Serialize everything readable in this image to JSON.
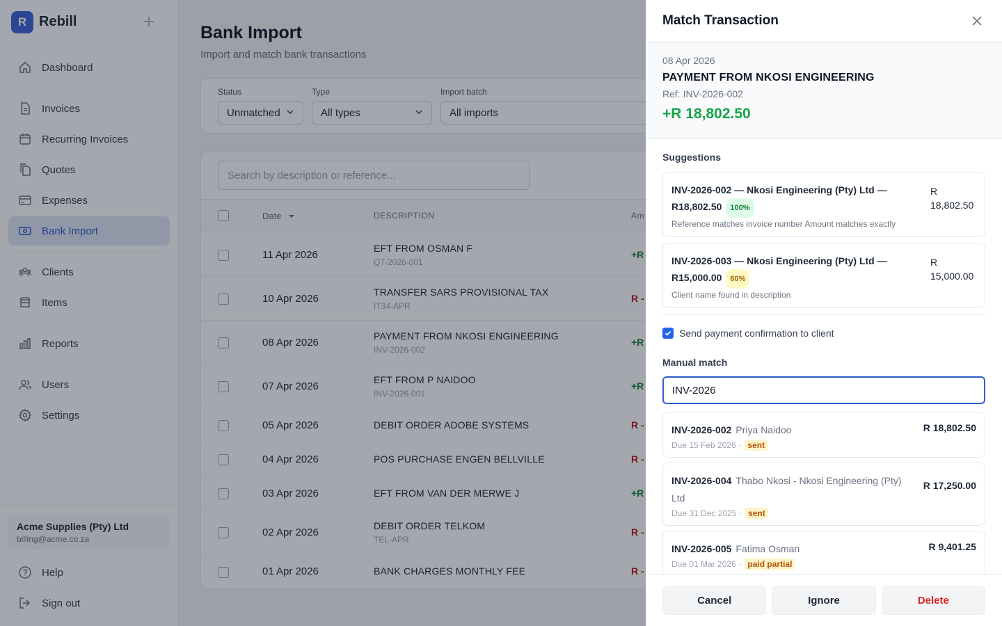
{
  "brand": {
    "letter": "R",
    "name": "Rebill",
    "add_icon": "plus-icon"
  },
  "sidebar": {
    "items": [
      {
        "label": "Dashboard",
        "icon": "home-icon"
      },
      {
        "label": "Invoices",
        "icon": "document-icon"
      },
      {
        "label": "Recurring Invoices",
        "icon": "calendar-icon"
      },
      {
        "label": "Quotes",
        "icon": "copy-icon"
      },
      {
        "label": "Expenses",
        "icon": "credit-card-icon"
      },
      {
        "label": "Bank Import",
        "icon": "banknote-icon",
        "active": true
      },
      {
        "label": "Clients",
        "icon": "users-icon"
      },
      {
        "label": "Items",
        "icon": "box-icon"
      },
      {
        "label": "Reports",
        "icon": "bar-chart-icon"
      },
      {
        "label": "Users",
        "icon": "user-group-icon"
      },
      {
        "label": "Settings",
        "icon": "gear-icon"
      }
    ],
    "account": {
      "name": "Acme Supplies (Pty) Ltd",
      "email": "billing@acme.co.za"
    },
    "help": "Help",
    "sign_out": "Sign out"
  },
  "page": {
    "title": "Bank Import",
    "subtitle": "Import and match bank transactions"
  },
  "filters": {
    "status": {
      "label": "Status",
      "value": "Unmatched"
    },
    "type": {
      "label": "Type",
      "value": "All types"
    },
    "batch": {
      "label": "Import batch",
      "value": "All imports"
    }
  },
  "table": {
    "search_placeholder": "Search by description or reference...",
    "headers": {
      "date": "Date",
      "description": "DESCRIPTION",
      "amount": "Am"
    },
    "rows": [
      {
        "date": "11 Apr 2026",
        "description": "EFT FROM OSMAN F",
        "ref": "QT-2026-001",
        "amount": "+R",
        "sign": "pos"
      },
      {
        "date": "10 Apr 2026",
        "description": "TRANSFER SARS PROVISIONAL TAX",
        "ref": "IT34-APR",
        "amount": "R -",
        "sign": "neg"
      },
      {
        "date": "08 Apr 2026",
        "description": "PAYMENT FROM NKOSI ENGINEERING",
        "ref": "INV-2026-002",
        "amount": "+R",
        "sign": "pos"
      },
      {
        "date": "07 Apr 2026",
        "description": "EFT FROM P NAIDOO",
        "ref": "INV-2026-001",
        "amount": "+R",
        "sign": "pos"
      },
      {
        "date": "05 Apr 2026",
        "description": "DEBIT ORDER ADOBE SYSTEMS",
        "ref": "",
        "amount": "R -",
        "sign": "neg"
      },
      {
        "date": "04 Apr 2026",
        "description": "POS PURCHASE ENGEN BELLVILLE",
        "ref": "",
        "amount": "R -",
        "sign": "neg"
      },
      {
        "date": "03 Apr 2026",
        "description": "EFT FROM VAN DER MERWE J",
        "ref": "",
        "amount": "+R",
        "sign": "pos"
      },
      {
        "date": "02 Apr 2026",
        "description": "DEBIT ORDER TELKOM",
        "ref": "TEL-APR",
        "amount": "R -",
        "sign": "neg"
      },
      {
        "date": "01 Apr 2026",
        "description": "BANK CHARGES MONTHLY FEE",
        "ref": "",
        "amount": "R -",
        "sign": "neg"
      }
    ]
  },
  "panel": {
    "title": "Match Transaction",
    "close_icon": "close-icon",
    "transaction": {
      "date": "08 Apr 2026",
      "description": "PAYMENT FROM NKOSI ENGINEERING",
      "ref": "Ref: INV-2026-002",
      "amount": "+R 18,802.50"
    },
    "suggestions_heading": "Suggestions",
    "suggestions": [
      {
        "title": "INV-2026-002 — Nkosi Engineering (Pty) Ltd — R18,802.50",
        "score": "100%",
        "reason": "Reference matches invoice number Amount matches exactly",
        "amount_currency": "R",
        "amount_value": "18,802.50"
      },
      {
        "title": "INV-2026-003 — Nkosi Engineering (Pty) Ltd — R15,000.00",
        "score": "60%",
        "reason": "Client name found in description",
        "amount_currency": "R",
        "amount_value": "15,000.00"
      }
    ],
    "send_confirmation": "Send payment confirmation to client",
    "manual_heading": "Manual match",
    "manual_query": "INV-2026",
    "results": [
      {
        "number": "INV-2026-002",
        "client": "Priya Naidoo",
        "due": "Due 15 Feb 2026 ·",
        "status": "sent",
        "amount": "R 18,802.50"
      },
      {
        "number": "INV-2026-004",
        "client": "Thabo Nkosi - Nkosi Engineering (Pty) Ltd",
        "due": "Due 31 Dec 2025 ·",
        "status": "sent",
        "amount": "R 17,250.00"
      },
      {
        "number": "INV-2026-005",
        "client": "Fatima Osman",
        "due": "Due 01 Mar 2026 ·",
        "status": "paid partial",
        "amount": "R 9,401.25"
      }
    ],
    "buttons": {
      "cancel": "Cancel",
      "ignore": "Ignore",
      "delete": "Delete"
    }
  }
}
